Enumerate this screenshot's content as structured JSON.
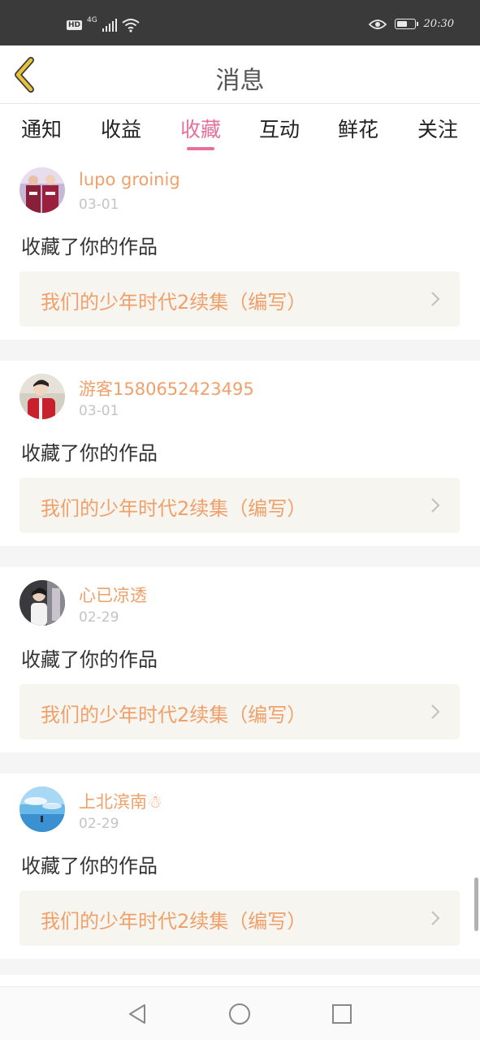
{
  "status_bar": {
    "left_badges": [
      "HD",
      "4G"
    ],
    "time": "20:30",
    "icons": [
      "signal-icon",
      "wifi-icon",
      "eye-icon",
      "battery-icon"
    ]
  },
  "header": {
    "title": "消息",
    "back_icon": "chevron-left-icon",
    "accent_color": "#e8c23a"
  },
  "tabs": {
    "items": [
      "通知",
      "收益",
      "收藏",
      "互动",
      "鲜花",
      "关注"
    ],
    "active_index": 2,
    "active_color": "#e6709a"
  },
  "feed": [
    {
      "username": "lupo groinig",
      "date": "03-01",
      "action": "收藏了你的作品",
      "work_title": "我们的少年时代2续集（编写）"
    },
    {
      "username": "游客1580652423495",
      "date": "03-01",
      "action": "收藏了你的作品",
      "work_title": "我们的少年时代2续集（编写）"
    },
    {
      "username": "心已凉透",
      "date": "02-29",
      "action": "收藏了你的作品",
      "work_title": "我们的少年时代2续集（编写）"
    },
    {
      "username": "上北滨南☃",
      "date": "02-29",
      "action": "收藏了你的作品",
      "work_title": "我们的少年时代2续集（编写）"
    }
  ],
  "nav_bar": {
    "icons": [
      "back-triangle-icon",
      "home-circle-icon",
      "recents-square-icon"
    ]
  },
  "colors": {
    "username": "#f0a06a",
    "work_title": "#f0a06a",
    "work_bg": "#f7f5ef"
  }
}
